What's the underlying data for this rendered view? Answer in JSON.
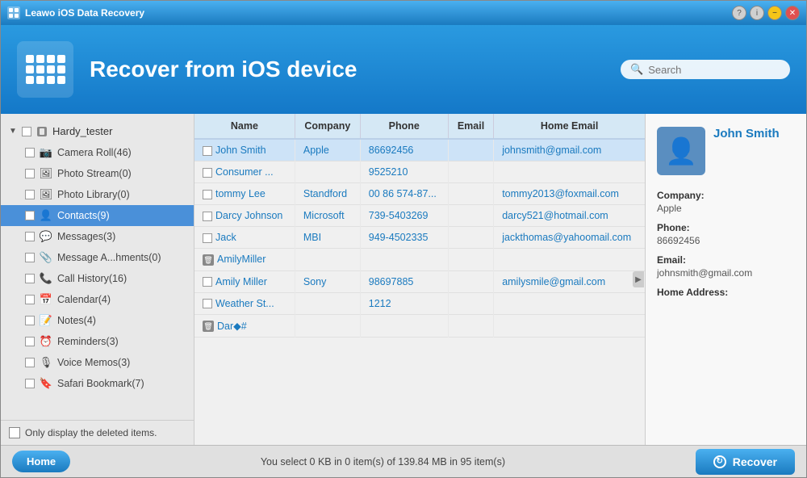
{
  "titlebar": {
    "title": "Leawo iOS Data Recovery"
  },
  "header": {
    "title": "Recover from iOS device",
    "search_placeholder": "Search"
  },
  "sidebar": {
    "root_label": "Hardy_tester",
    "items": [
      {
        "id": "camera-roll",
        "label": "Camera Roll(46)",
        "icon": "📷",
        "active": false
      },
      {
        "id": "photo-stream",
        "label": "Photo Stream(0)",
        "icon": "🖼",
        "active": false
      },
      {
        "id": "photo-library",
        "label": "Photo Library(0)",
        "icon": "🖼",
        "active": false
      },
      {
        "id": "contacts",
        "label": "Contacts(9)",
        "icon": "👤",
        "active": true
      },
      {
        "id": "messages",
        "label": "Messages(3)",
        "icon": "💬",
        "active": false
      },
      {
        "id": "message-attachments",
        "label": "Message A...hments(0)",
        "icon": "📎",
        "active": false
      },
      {
        "id": "call-history",
        "label": "Call History(16)",
        "icon": "📞",
        "active": false
      },
      {
        "id": "calendar",
        "label": "Calendar(4)",
        "icon": "📅",
        "active": false
      },
      {
        "id": "notes",
        "label": "Notes(4)",
        "icon": "📝",
        "active": false
      },
      {
        "id": "reminders",
        "label": "Reminders(3)",
        "icon": "⏰",
        "active": false
      },
      {
        "id": "voice-memos",
        "label": "Voice Memos(3)",
        "icon": "🎙",
        "active": false
      },
      {
        "id": "safari-bookmark",
        "label": "Safari Bookmark(7)",
        "icon": "🔖",
        "active": false
      }
    ],
    "footer_label": "Only display the deleted items."
  },
  "table": {
    "columns": [
      "Name",
      "Company",
      "Phone",
      "Email",
      "Home Email"
    ],
    "rows": [
      {
        "id": 1,
        "name": "John Smith",
        "company": "Apple",
        "phone": "86692456",
        "email": "",
        "home_email": "johnsmith@gmail.com",
        "selected": true,
        "deleted": false
      },
      {
        "id": 2,
        "name": "Consumer ...",
        "company": "",
        "phone": "9525210",
        "email": "",
        "home_email": "",
        "selected": false,
        "deleted": false
      },
      {
        "id": 3,
        "name": "tommy Lee",
        "company": "Standford",
        "phone": "00 86 574-87...",
        "email": "",
        "home_email": "tommy2013@foxmail.com",
        "selected": false,
        "deleted": false
      },
      {
        "id": 4,
        "name": "Darcy Johnson",
        "company": "Microsoft",
        "phone": "739-5403269",
        "email": "",
        "home_email": "darcy521@hotmail.com",
        "selected": false,
        "deleted": false
      },
      {
        "id": 5,
        "name": "Jack",
        "company": "MBI",
        "phone": "949-4502335",
        "email": "",
        "home_email": "jackthomas@yahoomail.com",
        "selected": false,
        "deleted": false
      },
      {
        "id": 6,
        "name": "AmilyMiller",
        "company": "",
        "phone": "",
        "email": "",
        "home_email": "",
        "selected": false,
        "deleted": true
      },
      {
        "id": 7,
        "name": "Amily Miller",
        "company": "Sony",
        "phone": "98697885",
        "email": "",
        "home_email": "amilysmile@gmail.com",
        "selected": false,
        "deleted": false
      },
      {
        "id": 8,
        "name": "Weather St...",
        "company": "",
        "phone": "1212",
        "email": "",
        "home_email": "",
        "selected": false,
        "deleted": false
      },
      {
        "id": 9,
        "name": "Dar◆#",
        "company": "",
        "phone": "",
        "email": "",
        "home_email": "",
        "selected": false,
        "deleted": true
      }
    ]
  },
  "detail": {
    "name": "John Smith",
    "company_label": "Company:",
    "company_value": "Apple",
    "phone_label": "Phone:",
    "phone_value": "86692456",
    "email_label": "Email:",
    "email_value": "johnsmith@gmail.com",
    "home_address_label": "Home Address:"
  },
  "statusbar": {
    "home_label": "Home",
    "status_text": "You select 0 KB in 0 item(s) of 139.84 MB in 95 item(s)",
    "recover_label": "Recover"
  }
}
